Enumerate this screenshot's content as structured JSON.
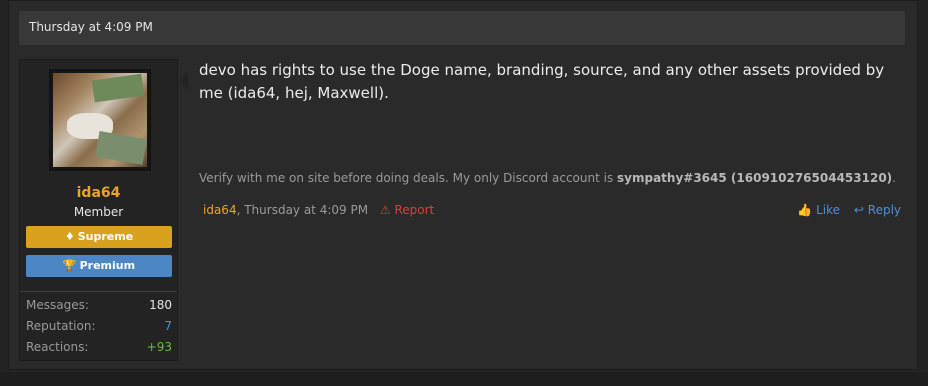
{
  "post": {
    "header_date": "Thursday at 4:09 PM",
    "message": "devo has rights to use the Doge name, branding, source, and any other assets provided by me (ida64, hej, Maxwell).",
    "signature": {
      "prefix": "Verify with me on site before doing deals. My only Discord account is ",
      "handle": "sympathy#3645 (160910276504453120)",
      "suffix": "."
    },
    "meta": {
      "author": "ida64",
      "separator": ", ",
      "timestamp": "Thursday at 4:09 PM",
      "report_label": "Report"
    },
    "actions": {
      "like_label": "Like",
      "reply_label": "Reply"
    }
  },
  "user": {
    "name": "ida64",
    "title": "Member",
    "badges": [
      {
        "label": "Supreme",
        "icon": "diamond-icon",
        "color": "#d9a21e"
      },
      {
        "label": "Premium",
        "icon": "trophy-icon",
        "color": "#4d86c5"
      }
    ],
    "stats": [
      {
        "label": "Messages:",
        "value": "180"
      },
      {
        "label": "Reputation:",
        "value": "7"
      },
      {
        "label": "Reactions:",
        "value": "+93"
      }
    ]
  },
  "colors": {
    "accent_orange": "#e8a628",
    "link_blue": "#4f8fd6",
    "report_red": "#e03b3b",
    "positive_green": "#6bbf3a"
  }
}
